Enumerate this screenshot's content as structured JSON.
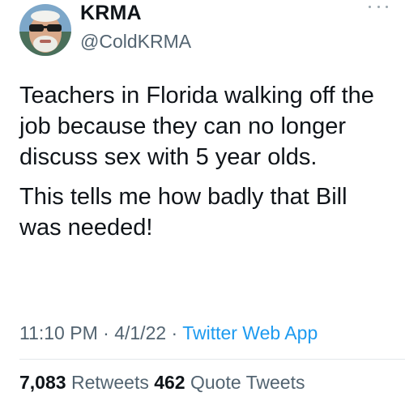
{
  "user": {
    "display_name": "KRMA",
    "handle": "@ColdKRMA"
  },
  "more_icon": "more-horizontal-icon",
  "tweet": {
    "paragraphs": [
      "Teachers in Florida walking off the job because they can no longer discuss sex with 5 year olds.",
      "This tells me how badly that Bill was needed!"
    ],
    "time": "11:10 PM",
    "separator": " · ",
    "date": "4/1/22",
    "source": "Twitter Web App"
  },
  "stats": {
    "retweets_count": "7,083",
    "retweets_label": "Retweets",
    "quote_count": "462",
    "quote_label": "Quote Tweets"
  },
  "colors": {
    "text": "#0f1419",
    "secondary": "#536471",
    "link": "#1d9bf0"
  }
}
